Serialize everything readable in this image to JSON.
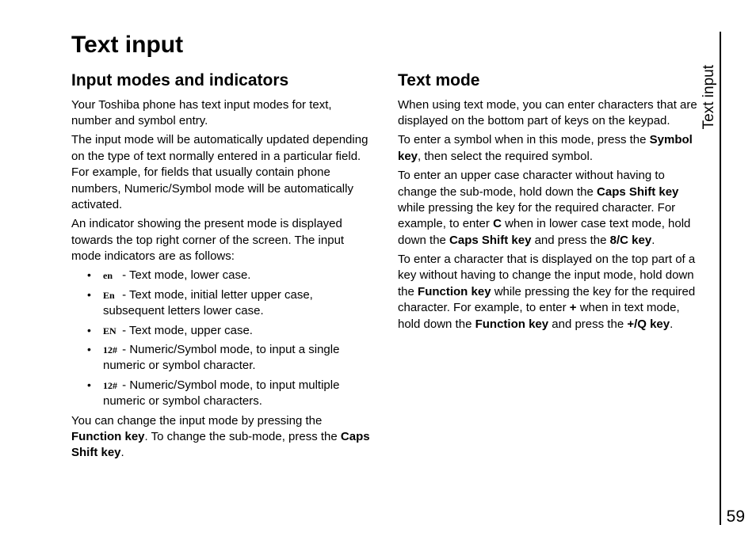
{
  "page": {
    "title": "Text input",
    "side_label": "Text input",
    "number": "59"
  },
  "left": {
    "heading": "Input modes and indicators",
    "p1": "Your Toshiba phone has text input modes for text, number and symbol entry.",
    "p2": "The input mode will be automatically updated depending on the type of text normally entered in a particular field. For example, for fields that usually contain phone numbers, Numeric/Symbol mode will be automatically activated.",
    "p3": "An indicator showing the present mode is displayed towards the top right corner of the screen. The input mode indicators are as follows:",
    "modes": [
      {
        "icon": "en",
        "text": " - Text mode, lower case."
      },
      {
        "icon": "En",
        "text": " - Text mode, initial letter upper case, subsequent letters lower case."
      },
      {
        "icon": "EN",
        "text": " - Text mode, upper case."
      },
      {
        "icon": "12#",
        "text": " - Numeric/Symbol mode, to input a single numeric or symbol character."
      },
      {
        "icon": "12#",
        "text": " - Numeric/Symbol mode, to input multiple numeric or symbol characters."
      }
    ],
    "p4a": "You can change the input mode by pressing the ",
    "p4b": "Function key",
    "p4c": ". To change the sub-mode, press the ",
    "p4d": "Caps Shift key",
    "p4e": "."
  },
  "right": {
    "heading": "Text mode",
    "p1": "When using text mode, you can enter characters that are displayed on the bottom part of keys on the keypad.",
    "p2a": "To enter a symbol when in this mode, press the ",
    "p2b": "Symbol key",
    "p2c": ", then select the required symbol.",
    "p3a": "To enter an upper case character without having to change the sub-mode, hold down the ",
    "p3b": "Caps Shift key",
    "p3c": " while pressing the key for the required character. For example, to enter ",
    "p3d": "C",
    "p3e": " when in lower case text mode, hold down the ",
    "p3f": "Caps Shift key",
    "p3g": " and press the ",
    "p3h": "8/C key",
    "p3i": ".",
    "p4a": "To enter a character that is displayed on the top part of a key without having to change the input mode, hold down the ",
    "p4b": "Function key",
    "p4c": " while pressing the key for the required character. For example, to enter ",
    "p4d": "+",
    "p4e": " when in text mode, hold down the ",
    "p4f": "Function key",
    "p4g": " and press the ",
    "p4h": "+/Q key",
    "p4i": "."
  }
}
